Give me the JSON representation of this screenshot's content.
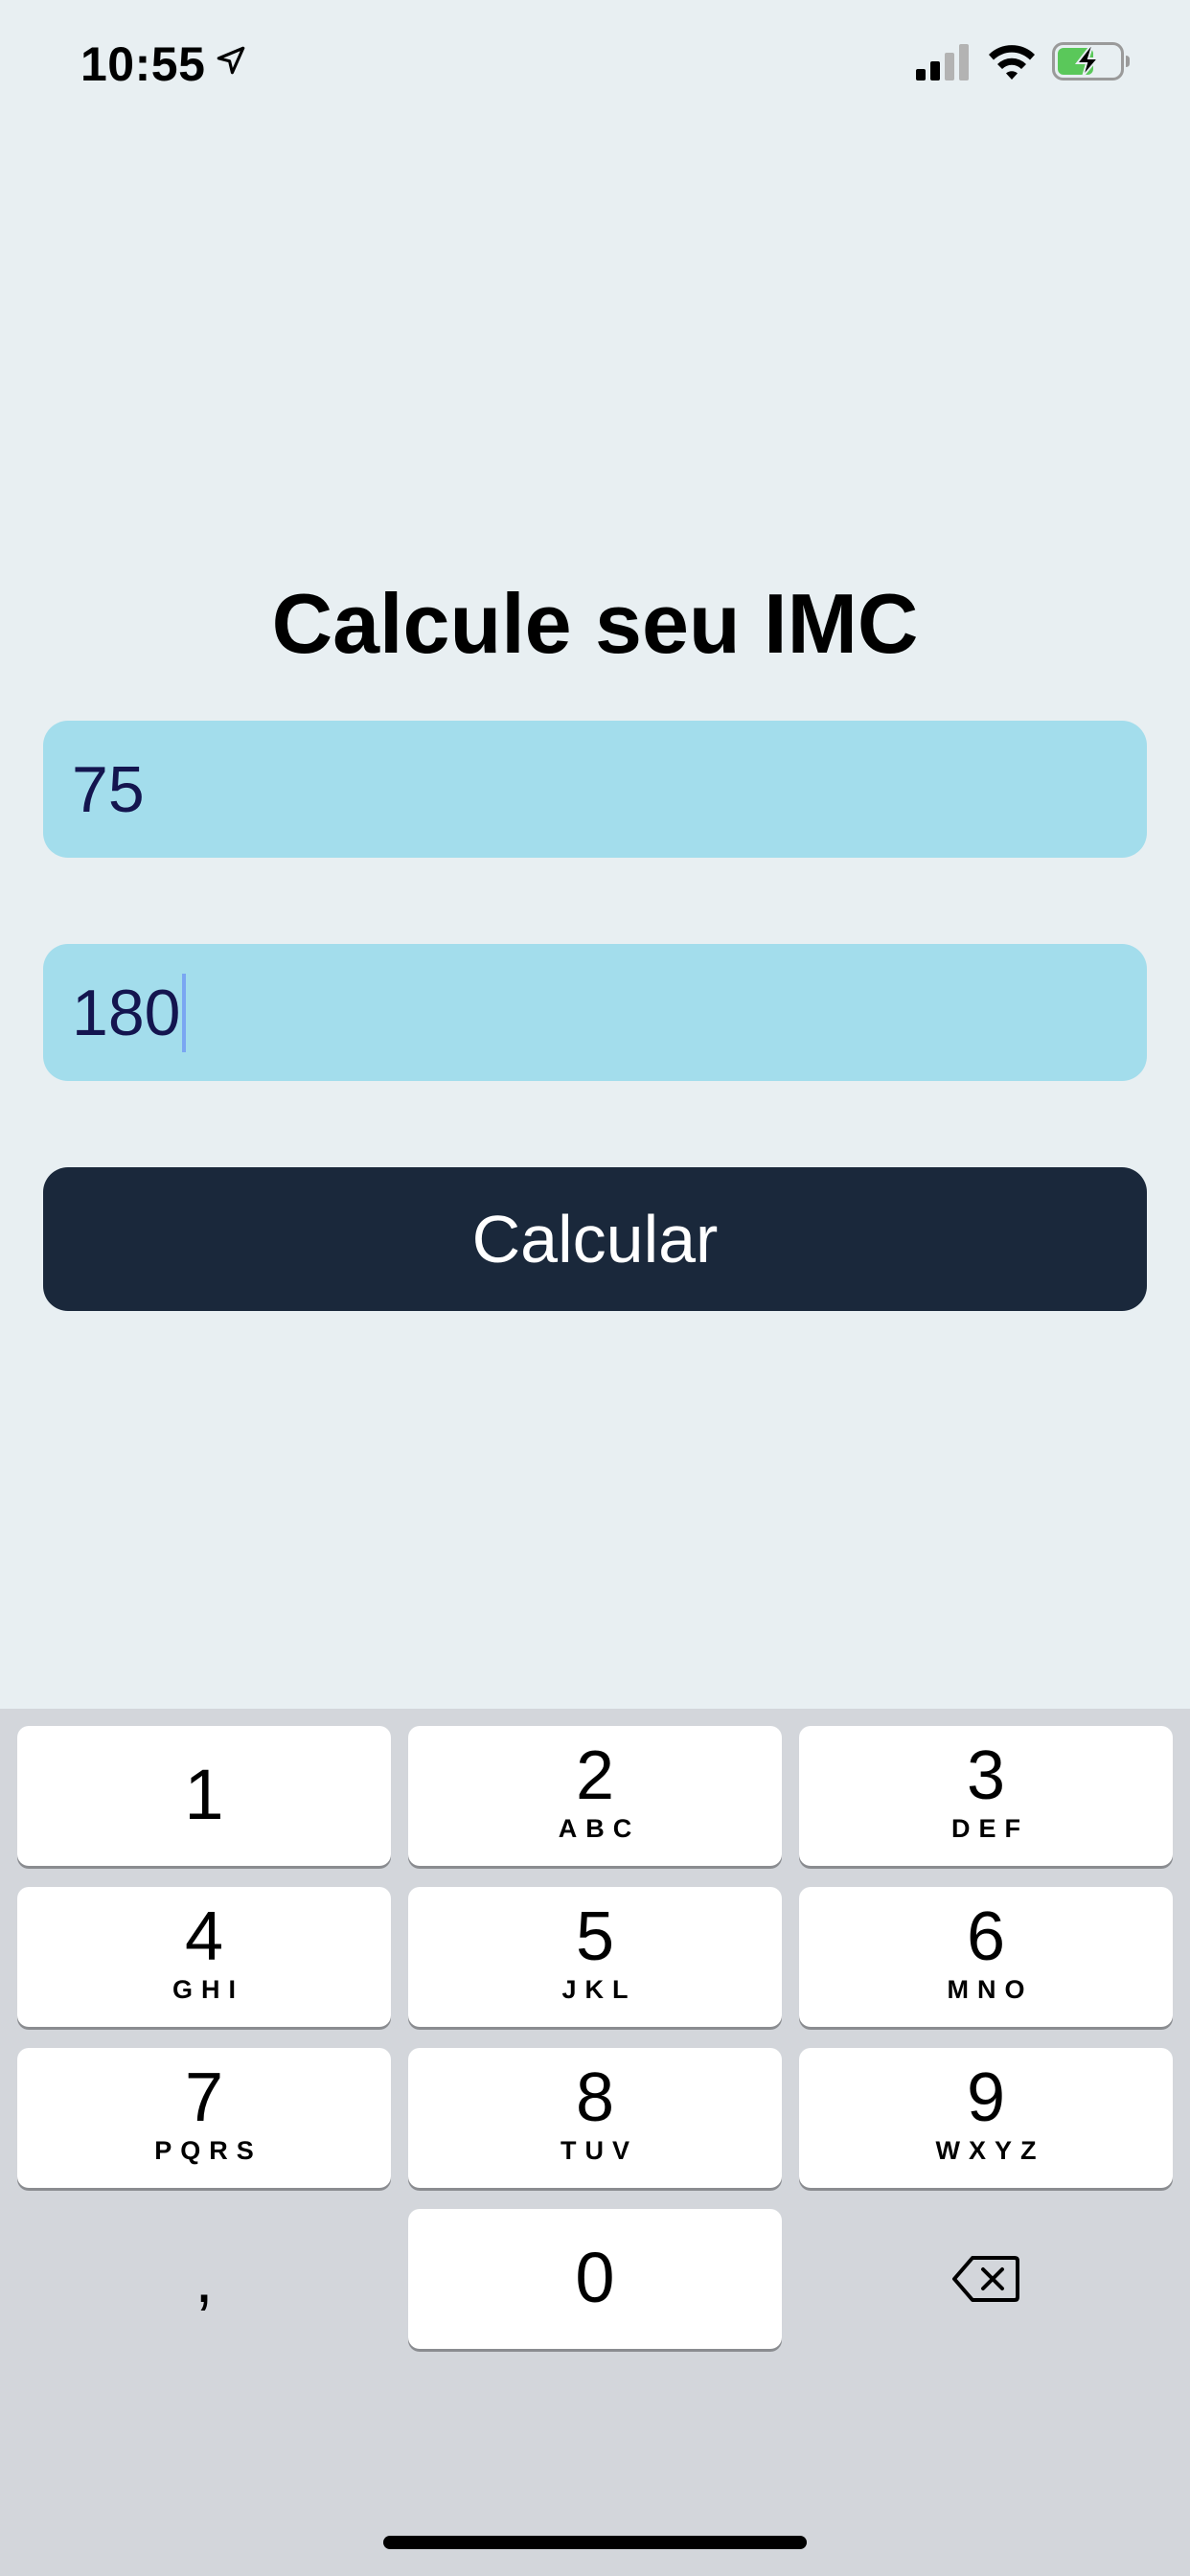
{
  "status_bar": {
    "time": "10:55",
    "icons": [
      "location-arrow-icon",
      "signal-icon",
      "wifi-icon",
      "battery-charging-icon"
    ],
    "battery_color": "#5ac85a"
  },
  "main": {
    "title": "Calcule seu IMC",
    "weight_value": "75",
    "height_value": "180",
    "button_label": "Calcular",
    "colors": {
      "background": "#e8eff2",
      "input_background": "#a3ddec",
      "input_text": "#14154f",
      "button_background": "#1a283b",
      "button_text": "#ffffff"
    }
  },
  "keyboard": {
    "keys": [
      {
        "digit": "1",
        "letters": ""
      },
      {
        "digit": "2",
        "letters": "ABC"
      },
      {
        "digit": "3",
        "letters": "DEF"
      },
      {
        "digit": "4",
        "letters": "GHI"
      },
      {
        "digit": "5",
        "letters": "JKL"
      },
      {
        "digit": "6",
        "letters": "MNO"
      },
      {
        "digit": "7",
        "letters": "PQRS"
      },
      {
        "digit": "8",
        "letters": "TUV"
      },
      {
        "digit": "9",
        "letters": "WXYZ"
      },
      {
        "digit": "0",
        "letters": ""
      }
    ],
    "comma_key": ",",
    "delete_icon": "backspace-icon"
  }
}
